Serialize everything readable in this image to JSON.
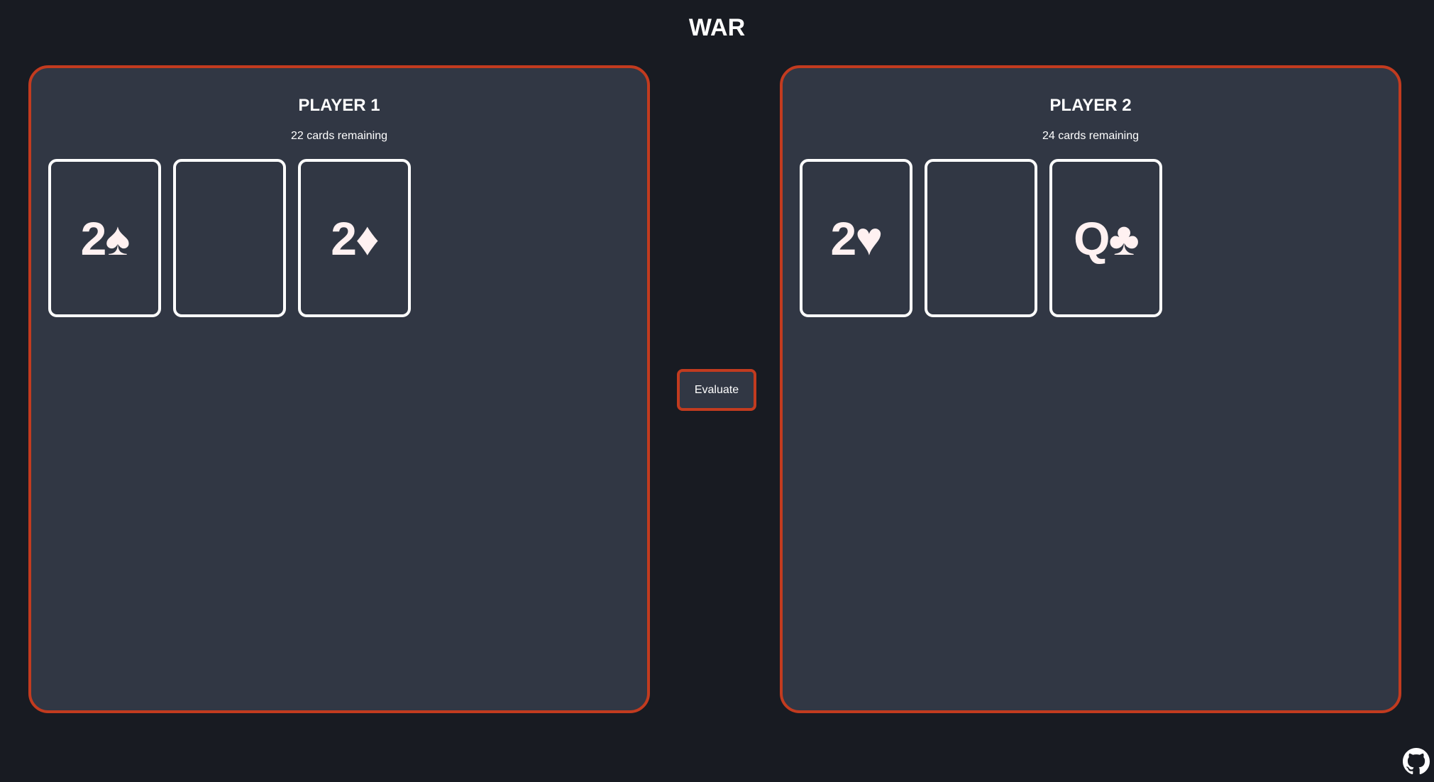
{
  "title": "WAR",
  "players": [
    {
      "name": "PLAYER 1",
      "remaining": "22 cards remaining",
      "cards": [
        "2♠",
        "",
        "2♦"
      ]
    },
    {
      "name": "PLAYER 2",
      "remaining": "24 cards remaining",
      "cards": [
        "2♥",
        "",
        "Q♣"
      ]
    }
  ],
  "evaluate_label": "Evaluate",
  "colors": {
    "background": "#181b22",
    "panel": "#313744",
    "accent": "#c23b1f",
    "card_border": "#ffffff"
  },
  "icons": {
    "footer": "github-icon"
  }
}
